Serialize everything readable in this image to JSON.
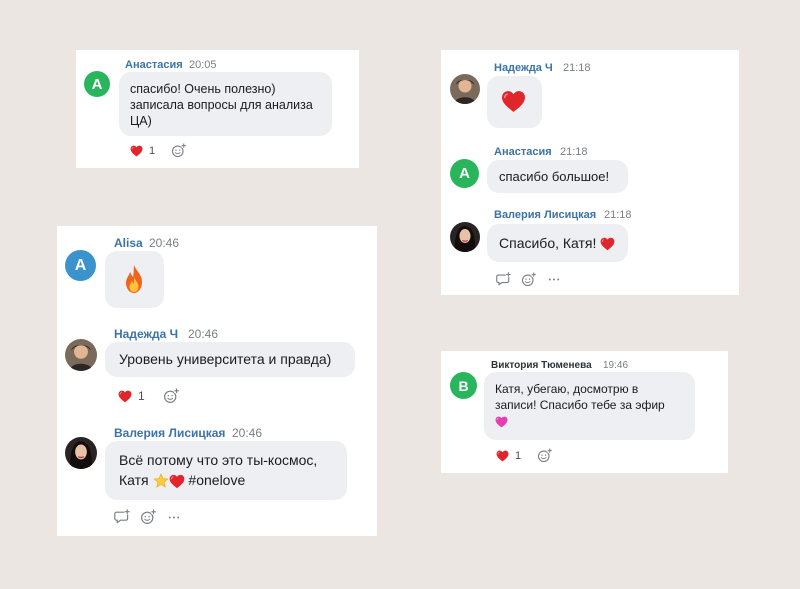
{
  "card1": {
    "name": "Анастасия",
    "time": "20:05",
    "avatar_letter": "А",
    "text": [
      "спасибо! Очень полезно)",
      "записала вопросы для анализа",
      "ЦА)"
    ],
    "reaction_count": "1"
  },
  "card2": {
    "m1": {
      "name": "Надежда Ч",
      "time": "21:18"
    },
    "m2": {
      "name": "Анастасия",
      "time": "21:18",
      "avatar_letter": "А",
      "text": "спасибо большое!"
    },
    "m3": {
      "name": "Валерия Лисицкая",
      "time": "21:18",
      "text": "Спасибо, Катя!"
    }
  },
  "card3": {
    "m1": {
      "name": "Alisa",
      "time": "20:46",
      "avatar_letter": "А"
    },
    "m2": {
      "name": "Надежда Ч",
      "time": "20:46",
      "text": "Уровень университета и правда)",
      "reaction_count": "1"
    },
    "m3": {
      "name": "Валерия Лисицкая",
      "time": "20:46",
      "line1": "Всё потому что это ты-космос,",
      "line2_start": "Катя",
      "line2_end": "#onelove"
    }
  },
  "card4": {
    "name": "Виктория Тюменева",
    "time": "19:46",
    "avatar_letter": "В",
    "text": [
      "Катя, убегаю, досмотрю в",
      "записи! Спасибо тебе за эфир"
    ],
    "reaction_count": "1"
  },
  "icons": [
    "heart-icon",
    "add-reaction-icon",
    "reply-icon",
    "more-icon",
    "fire-icon",
    "star-icon",
    "pink-heart-icon"
  ],
  "colors": {
    "background": "#ebe6e1",
    "name": "#3c73a8",
    "bubble": "#eeeff2",
    "avatar_green": "#29b55c",
    "avatar_blue": "#3a93cc",
    "heart": "#e0252b"
  }
}
